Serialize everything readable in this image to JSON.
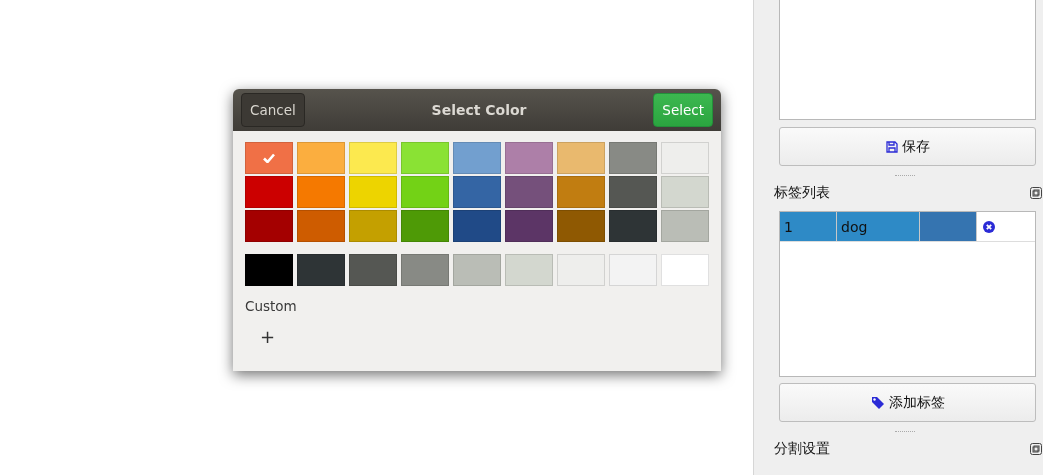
{
  "dialog": {
    "title": "Select Color",
    "cancel_button": "Cancel",
    "select_button": "Select",
    "palette": [
      [
        {
          "color": "#f07046",
          "selected": true
        },
        {
          "color": "#fbae3f",
          "selected": false
        },
        {
          "color": "#fce94f",
          "selected": false
        },
        {
          "color": "#8ae234",
          "selected": false
        },
        {
          "color": "#729fcf",
          "selected": false
        },
        {
          "color": "#ad7fa8",
          "selected": false
        },
        {
          "color": "#e9b96e",
          "selected": false
        },
        {
          "color": "#888a85",
          "selected": false
        },
        {
          "color": "#eeeeec",
          "selected": false
        }
      ],
      [
        {
          "color": "#cc0000",
          "selected": false
        },
        {
          "color": "#f57900",
          "selected": false
        },
        {
          "color": "#edd400",
          "selected": false
        },
        {
          "color": "#73d216",
          "selected": false
        },
        {
          "color": "#3465a4",
          "selected": false
        },
        {
          "color": "#75507b",
          "selected": false
        },
        {
          "color": "#c17d11",
          "selected": false
        },
        {
          "color": "#555753",
          "selected": false
        },
        {
          "color": "#d3d7cf",
          "selected": false
        }
      ],
      [
        {
          "color": "#a40000",
          "selected": false
        },
        {
          "color": "#ce5c00",
          "selected": false
        },
        {
          "color": "#c4a000",
          "selected": false
        },
        {
          "color": "#4e9a06",
          "selected": false
        },
        {
          "color": "#204a87",
          "selected": false
        },
        {
          "color": "#5c3566",
          "selected": false
        },
        {
          "color": "#8f5902",
          "selected": false
        },
        {
          "color": "#2e3436",
          "selected": false
        },
        {
          "color": "#babdb6",
          "selected": false
        }
      ]
    ],
    "grays": [
      {
        "color": "#000000",
        "selected": false
      },
      {
        "color": "#2e3436",
        "selected": false
      },
      {
        "color": "#555753",
        "selected": false
      },
      {
        "color": "#888a85",
        "selected": false
      },
      {
        "color": "#babdb6",
        "selected": false
      },
      {
        "color": "#d3d7cf",
        "selected": false
      },
      {
        "color": "#eeeeec",
        "selected": false
      },
      {
        "color": "#f3f3f3",
        "selected": false
      },
      {
        "color": "#ffffff",
        "selected": false
      }
    ],
    "custom_label": "Custom",
    "add_custom": "+"
  },
  "side_panel": {
    "save_button": "保存",
    "label_list": {
      "title": "标签列表",
      "rows": [
        {
          "index": "1",
          "name": "dog",
          "color": "#3574b0",
          "selected": true
        }
      ]
    },
    "add_label_button": "添加标签",
    "segmentation": {
      "title": "分割设置"
    }
  }
}
